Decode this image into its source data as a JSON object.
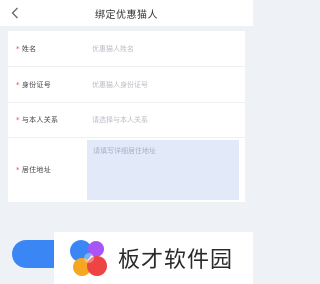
{
  "nav": {
    "title": "绑定优惠猫人",
    "back_icon": "chevron-left-icon"
  },
  "form": {
    "name": {
      "required_mark": "*",
      "label": "姓名",
      "placeholder": "优惠猫人姓名"
    },
    "id_number": {
      "required_mark": "*",
      "label": "身份证号",
      "placeholder": "优惠猫人身份证号"
    },
    "relation": {
      "required_mark": "*",
      "label": "与本人关系",
      "placeholder": "请选择与本人关系"
    },
    "address": {
      "required_mark": "*",
      "label": "居住地址",
      "placeholder": "请填写详细居住地址"
    }
  },
  "watermark": {
    "text": "板才软件园"
  },
  "colors": {
    "accent": "#3a86f5",
    "required": "#e8453c",
    "background": "#eef1f6",
    "address_fill": "#e2e9f8"
  }
}
